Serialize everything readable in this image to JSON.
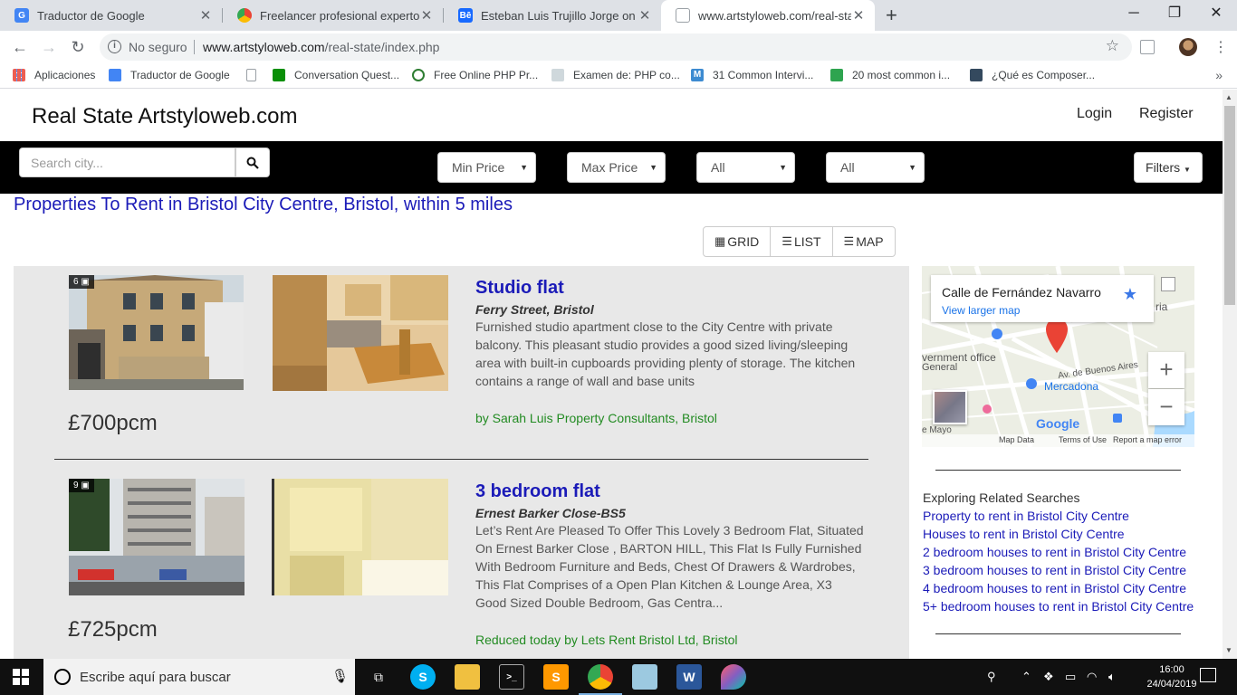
{
  "browser": {
    "tabs": [
      {
        "title": "Traductor de Google",
        "favicon_color": "#4285f4"
      },
      {
        "title": "Freelancer profesional experto en",
        "favicon_color": "#ea4335"
      },
      {
        "title": "Esteban Luis Trujillo Jorge on Beh",
        "favicon_color": "#1769ff"
      },
      {
        "title": "www.artstyloweb.com/real-state/",
        "favicon_color": "#9aa0a6"
      }
    ],
    "new_tab": "+",
    "window_controls": {
      "minimize": "─",
      "maximize": "❐",
      "close": "✕"
    },
    "omnibox": {
      "security": "No seguro",
      "host": "www.artstyloweb.com",
      "path": "/real-state/index.php"
    }
  },
  "bookmarks": {
    "items": [
      {
        "label": "Aplicaciones",
        "color": "#ea4335"
      },
      {
        "label": "Traductor de Google",
        "color": "#4285f4"
      },
      {
        "label": "",
        "color": "#9aa0a6"
      },
      {
        "label": "Conversation Quest...",
        "color": "#0a8f08"
      },
      {
        "label": "Free Online PHP Pr...",
        "color": "#2e7d32"
      },
      {
        "label": "Examen de: PHP co...",
        "color": "#9aa0a6"
      },
      {
        "label": "31 Common Intervi...",
        "color": "#3d8bd1"
      },
      {
        "label": "20 most common i...",
        "color": "#2ea44f"
      },
      {
        "label": "¿Qué es Composer...",
        "color": "#34495e"
      }
    ],
    "more": "»"
  },
  "site": {
    "brand": "Real State Artstyloweb.com",
    "nav": {
      "login": "Login",
      "register": "Register"
    },
    "search": {
      "placeholder": "Search city...",
      "min_price": "Min Price",
      "max_price": "Max Price",
      "type1": "All",
      "type2": "All",
      "filters": "Filters"
    },
    "results_title": "Properties To Rent in Bristol City Centre, Bristol, within 5 miles",
    "view_modes": {
      "grid": "GRID",
      "list": "LIST",
      "map": "MAP"
    },
    "listings": [
      {
        "photo_count": "6",
        "price": "£700pcm",
        "title": "Studio flat",
        "address": "Ferry Street, Bristol",
        "description": "Furnished studio apartment close to the City Centre with private balcony. This pleasant studio provides a good sized living/sleeping area with built-in cupboards providing plenty of storage. The kitchen contains a range of wall and base units",
        "agent": "by Sarah Luis Property Consultants, Bristol"
      },
      {
        "photo_count": "9",
        "price": "£725pcm",
        "title": "3 bedroom flat",
        "address": "Ernest Barker Close-BS5",
        "description": "Let’s Rent Are Pleased To Offer This Lovely 3 Bedroom Flat, Situated On Ernest Barker Close , BARTON HILL, This Flat Is Fully Furnished With Bedroom Furniture and Beds, Chest Of Drawers & Wardrobes, This Flat Comprises of a Open Plan Kitchen & Lounge Area, X3 Good Sized Double Bedroom, Gas Centra...",
        "agent": "Reduced today by Lets Rent Bristol Ltd, Bristol"
      }
    ],
    "map": {
      "place": "Calle de Fernández Navarro",
      "larger_map": "View larger map",
      "labels": {
        "government": "vernment office",
        "general": "General",
        "avenue": "Av. de Buenos Aires",
        "mercadona": "Mercadona",
        "ria": "ria",
        "mayo": "e Mayo",
        "google": "Google"
      },
      "zoom_in": "+",
      "zoom_out": "−",
      "footer": {
        "data": "Map Data",
        "terms": "Terms of Use",
        "report": "Report a map error"
      }
    },
    "related": {
      "heading": "Exploring Related Searches",
      "links": [
        "Property to rent in Bristol City Centre",
        "Houses to rent in Bristol City Centre",
        "2 bedroom houses to rent in Bristol City Centre",
        "3 bedroom houses to rent in Bristol City Centre",
        "4 bedroom houses to rent in Bristol City Centre",
        "5+ bedroom houses to rent in Bristol City Centre"
      ]
    }
  },
  "taskbar": {
    "search_placeholder": "Escribe aquí para buscar",
    "time": "16:00",
    "date": "24/04/2019"
  }
}
